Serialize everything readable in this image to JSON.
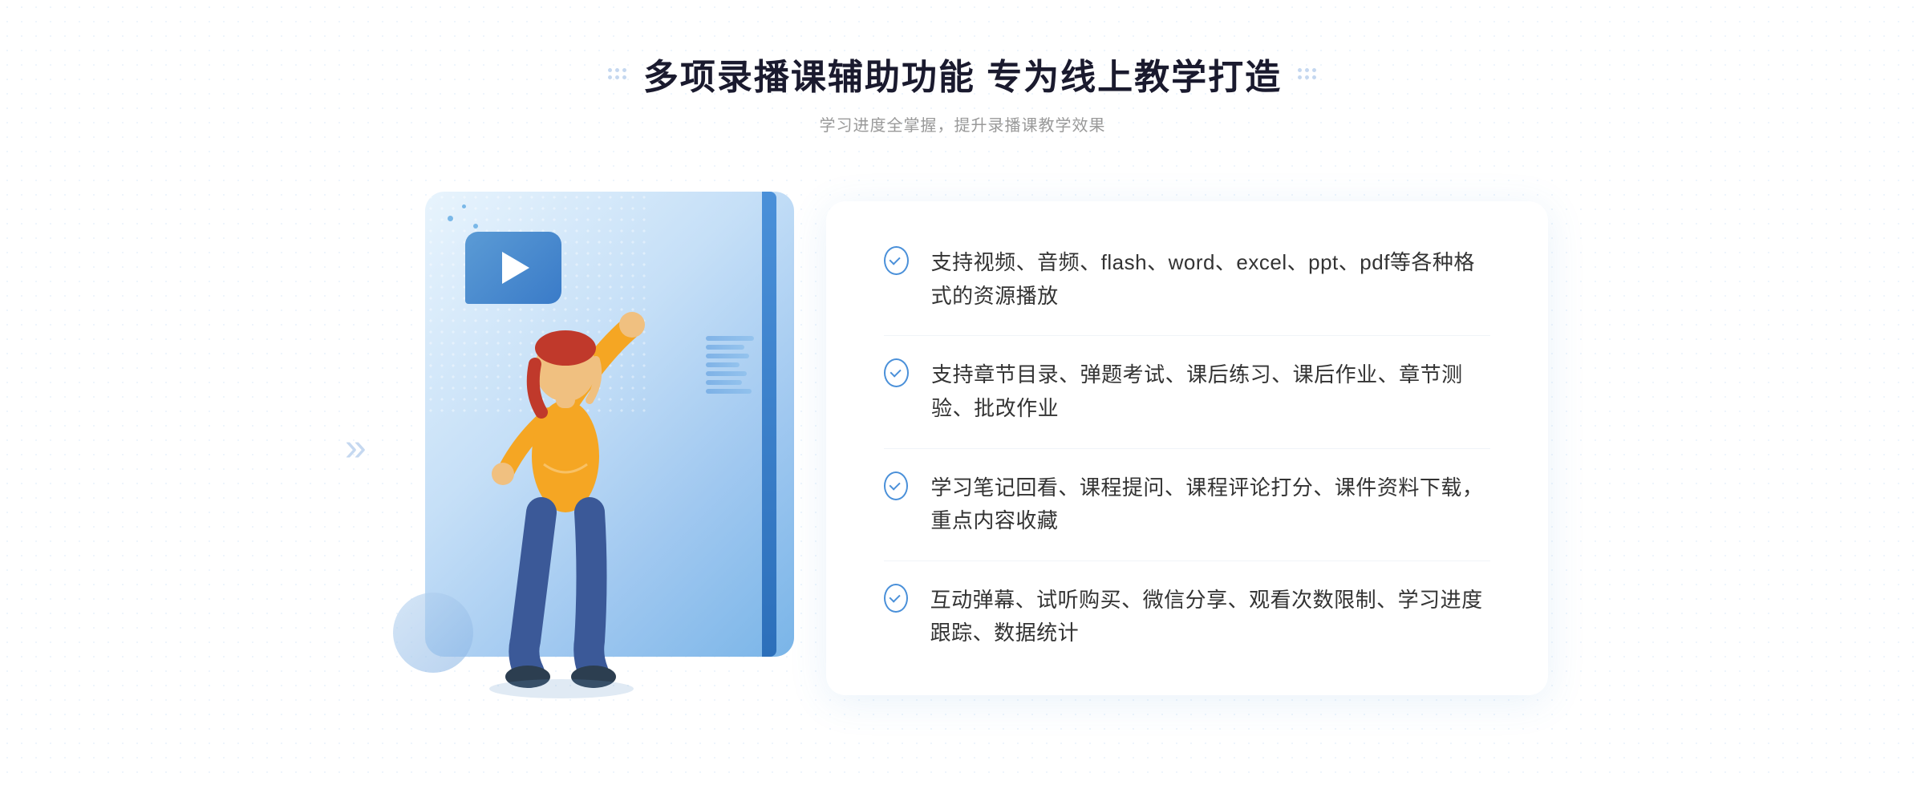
{
  "header": {
    "title": "多项录播课辅助功能 专为线上教学打造",
    "subtitle": "学习进度全掌握，提升录播课教学效果"
  },
  "features": [
    {
      "id": 1,
      "text": "支持视频、音频、flash、word、excel、ppt、pdf等各种格式的资源播放"
    },
    {
      "id": 2,
      "text": "支持章节目录、弹题考试、课后练习、课后作业、章节测验、批改作业"
    },
    {
      "id": 3,
      "text": "学习笔记回看、课程提问、课程评论打分、课件资料下载，重点内容收藏"
    },
    {
      "id": 4,
      "text": "互动弹幕、试听购买、微信分享、观看次数限制、学习进度跟踪、数据统计"
    }
  ],
  "decorative": {
    "chevron": "»"
  }
}
